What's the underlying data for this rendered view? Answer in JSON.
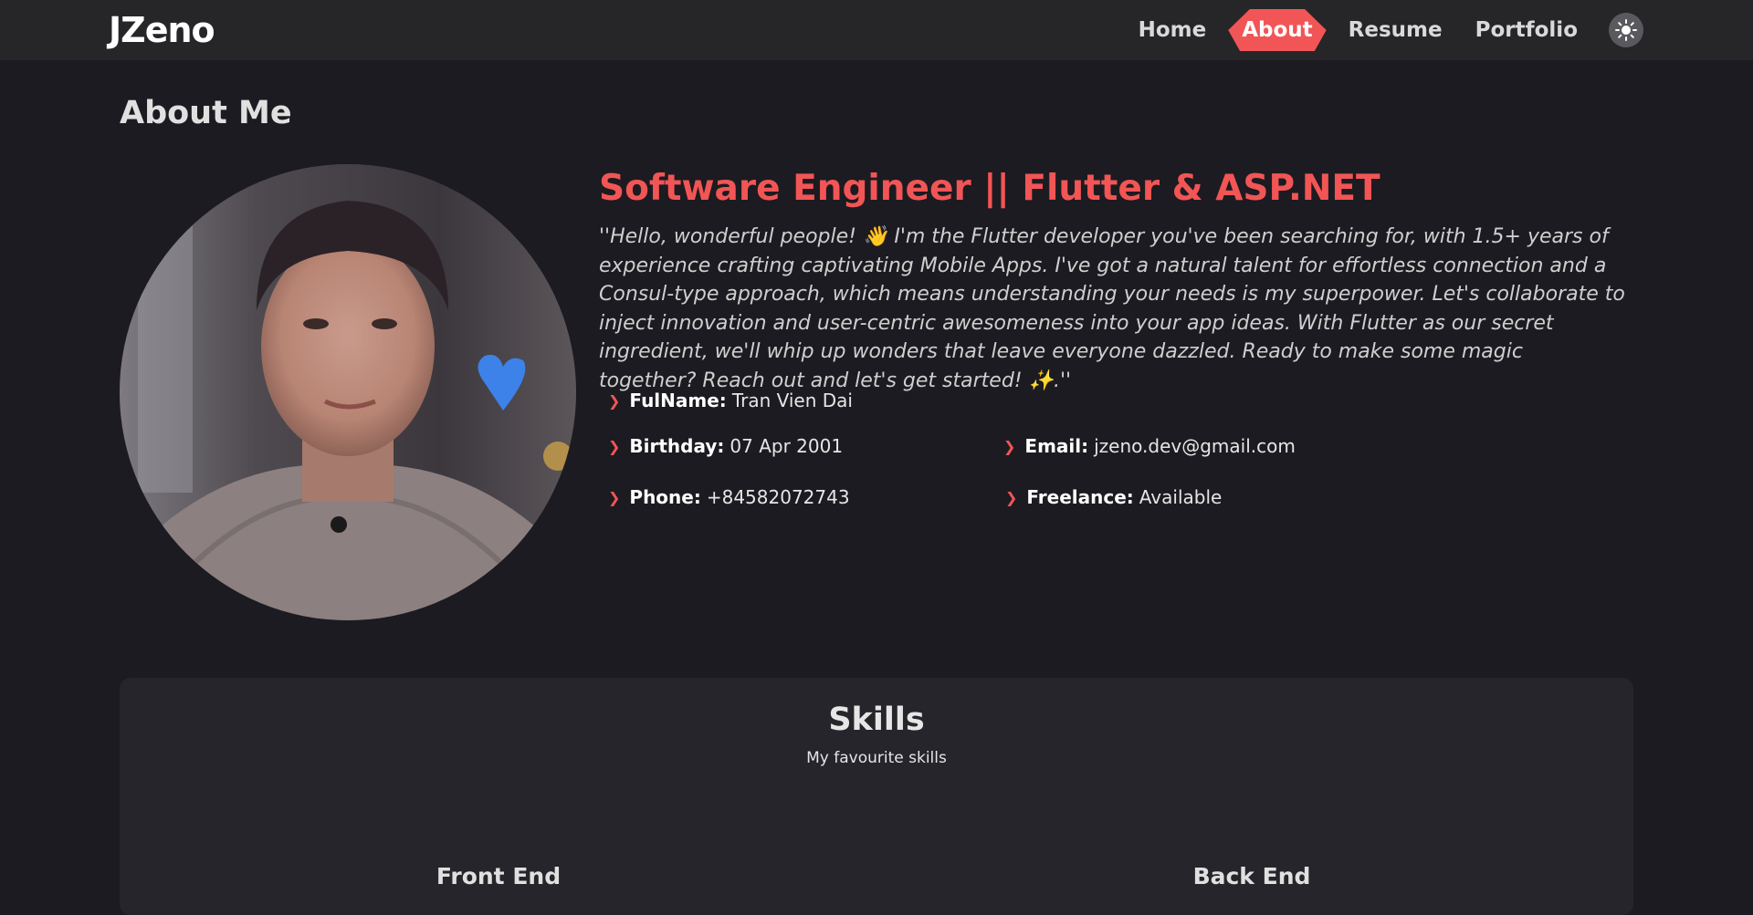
{
  "header": {
    "logo": "JZeno",
    "nav": [
      {
        "label": "Home",
        "active": false
      },
      {
        "label": "About",
        "active": true
      },
      {
        "label": "Resume",
        "active": false
      },
      {
        "label": "Portfolio",
        "active": false
      }
    ],
    "theme_toggle_icon": "sun-icon"
  },
  "main": {
    "title": "About Me",
    "headline": "Software Engineer || Flutter & ASP.NET",
    "bio": "''Hello, wonderful people! 👋 I'm the Flutter developer you've been searching for, with 1.5+ years of experience crafting captivating Mobile Apps. I've got a natural talent for effortless connection and a Consul-type approach, which means understanding your needs is my superpower. Let's collaborate to inject innovation and user-centric awesomeness into your app ideas. With Flutter as our secret ingredient, we'll whip up wonders that leave everyone dazzled. Ready to make some magic together? Reach out and let's get started! ✨.''",
    "info": {
      "fullname_label": "FulName:",
      "fullname": "Tran Vien Dai",
      "birthday_label": "Birthday:",
      "birthday": "07 Apr 2001",
      "email_label": "Email:",
      "email": "jzeno.dev@gmail.com",
      "phone_label": "Phone:",
      "phone": "+84582072743",
      "freelance_label": "Freelance:",
      "freelance": "Available"
    },
    "avatar_icon": "profile-photo"
  },
  "skills": {
    "title": "Skills",
    "subtitle": "My favourite skills",
    "front_end": "Front End",
    "back_end": "Back End"
  },
  "colors": {
    "accent": "#f25555",
    "background": "#1c1b21",
    "navbar": "#262629",
    "card": "#25252b"
  }
}
